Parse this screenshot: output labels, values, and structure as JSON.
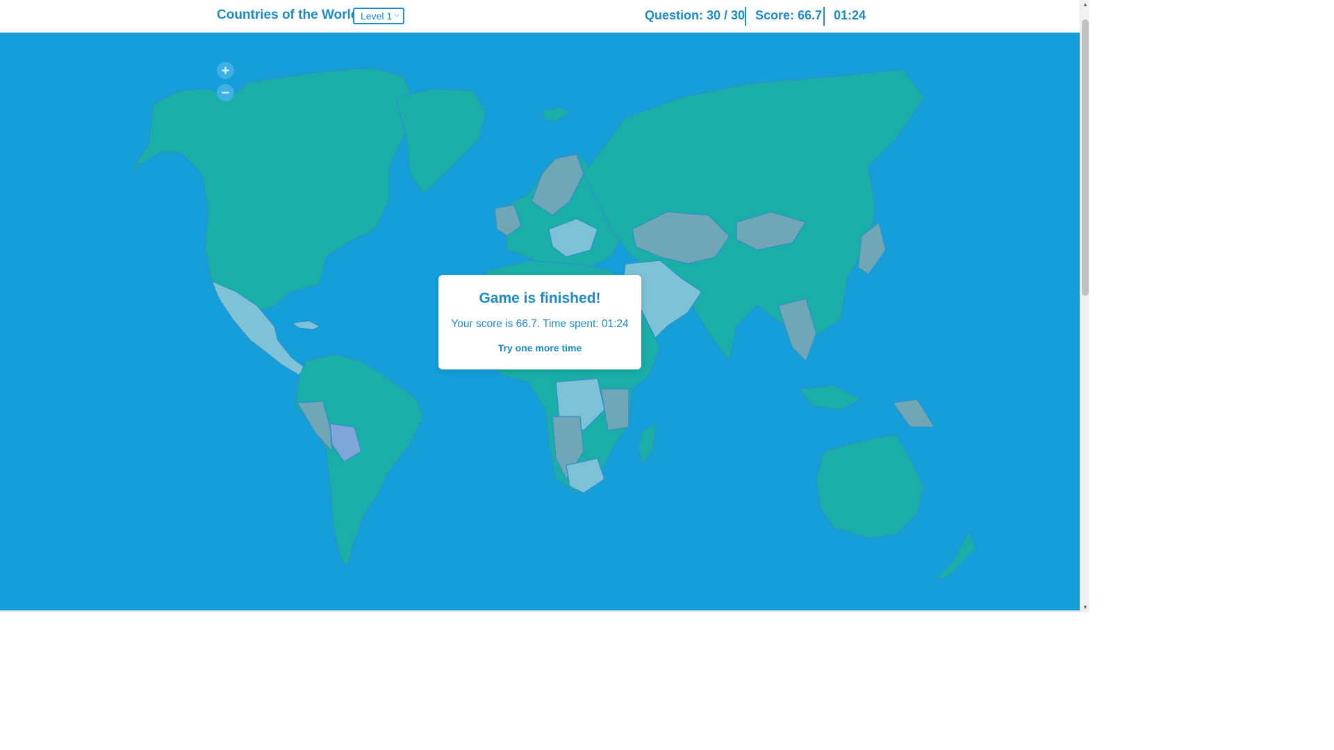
{
  "header": {
    "title": "Countries of the World",
    "level_select": {
      "selected": "Level 1"
    },
    "question": "Question: 30 / 30",
    "score": "Score: 66.7",
    "timer": "01:24"
  },
  "map": {
    "zoom_in": "+",
    "zoom_out": "−",
    "colors": {
      "ocean": "#149fdb",
      "land_teal": "#1aaea8",
      "land_gray": "#6fa7b7",
      "land_lightblue": "#7dc2d6",
      "land_periwinkle": "#7ea6d6",
      "border": "#2b8fc8"
    }
  },
  "modal": {
    "title": "Game is finished!",
    "message": "Your score is 66.7. Time spent: 01:24",
    "retry_link": "Try one more time"
  },
  "scrollbar": {
    "up_icon": "scroll-up-arrow-icon",
    "down_icon": "scroll-down-arrow-icon"
  }
}
